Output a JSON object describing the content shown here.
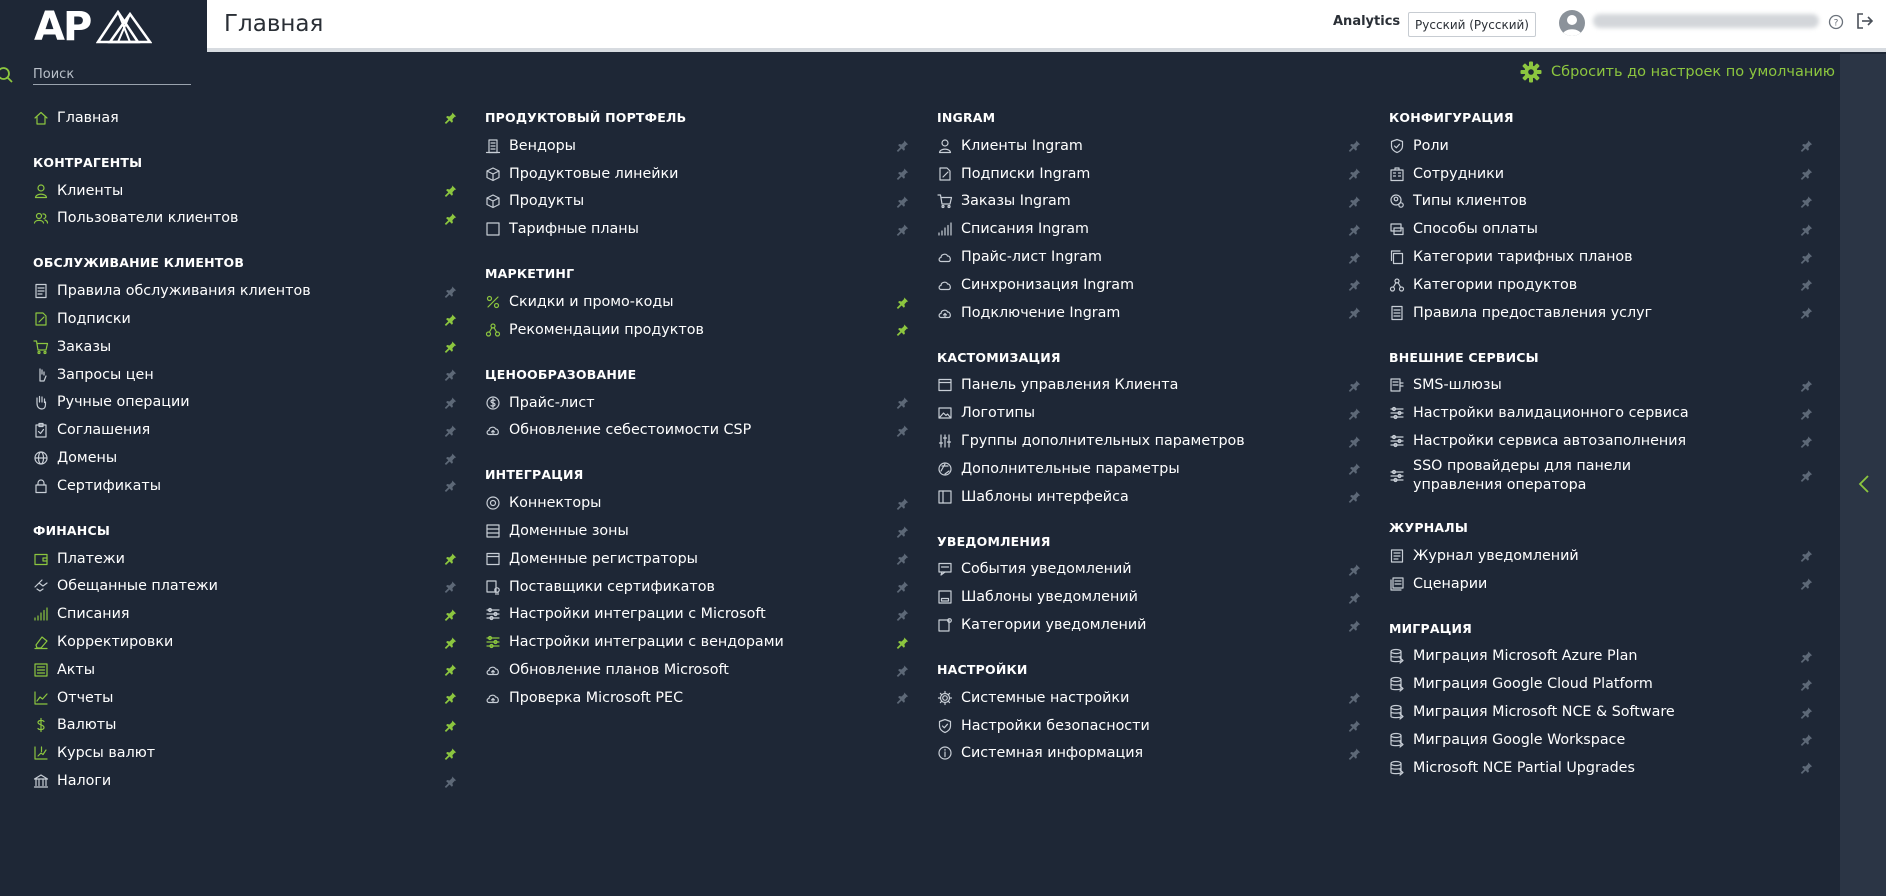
{
  "header": {
    "logo_text": "AP",
    "title": "Главная",
    "analytics_label": "Analytics",
    "language": "Русский (Русский)"
  },
  "search": {
    "placeholder": "Поиск",
    "value": ""
  },
  "reset_label": "Сбросить до настроек по умолчанию",
  "colors": {
    "accent": "#8cc63f",
    "background": "#1e2736",
    "pin_inactive": "#5d6877",
    "icon_outline": "#c8ced6"
  },
  "columns": [
    {
      "sections": [
        {
          "title": "",
          "items": [
            {
              "label": "Главная",
              "icon": "home-icon",
              "pinned": true,
              "accent_icon": true
            }
          ]
        },
        {
          "title": "КОНТРАГЕНТЫ",
          "items": [
            {
              "label": "Клиенты",
              "icon": "user-icon",
              "pinned": true,
              "accent_icon": true
            },
            {
              "label": "Пользователи клиентов",
              "icon": "users-icon",
              "pinned": true,
              "accent_icon": true
            }
          ]
        },
        {
          "title": "ОБСЛУЖИВАНИЕ КЛИЕНТОВ",
          "items": [
            {
              "label": "Правила обслуживания клиентов",
              "icon": "document-icon",
              "pinned": false
            },
            {
              "label": "Подписки",
              "icon": "edit-icon",
              "pinned": true,
              "accent_icon": true
            },
            {
              "label": "Заказы",
              "icon": "cart-icon",
              "pinned": true,
              "accent_icon": true
            },
            {
              "label": "Запросы цен",
              "icon": "hand-icon",
              "pinned": false
            },
            {
              "label": "Ручные операции",
              "icon": "hand-palm-icon",
              "pinned": false
            },
            {
              "label": "Соглашения",
              "icon": "clipboard-icon",
              "pinned": false
            },
            {
              "label": "Домены",
              "icon": "globe-icon",
              "pinned": false
            },
            {
              "label": "Сертификаты",
              "icon": "lock-icon",
              "pinned": false
            }
          ]
        },
        {
          "title": "ФИНАНСЫ",
          "items": [
            {
              "label": "Платежи",
              "icon": "wallet-icon",
              "pinned": true,
              "accent_icon": true
            },
            {
              "label": "Обещанные платежи",
              "icon": "handshake-icon",
              "pinned": false
            },
            {
              "label": "Списания",
              "icon": "signal-icon",
              "pinned": true,
              "accent_icon": true
            },
            {
              "label": "Корректировки",
              "icon": "eraser-icon",
              "pinned": true,
              "accent_icon": true
            },
            {
              "label": "Акты",
              "icon": "list-icon",
              "pinned": true,
              "accent_icon": true
            },
            {
              "label": "Отчеты",
              "icon": "chart-icon",
              "pinned": true,
              "accent_icon": true
            },
            {
              "label": "Валюты",
              "icon": "dollar-icon",
              "pinned": true,
              "accent_icon": true
            },
            {
              "label": "Курсы валют",
              "icon": "rate-icon",
              "pinned": true,
              "accent_icon": true
            },
            {
              "label": "Налоги",
              "icon": "bank-icon",
              "pinned": false
            }
          ]
        }
      ]
    },
    {
      "sections": [
        {
          "title": "ПРОДУКТОВЫЙ ПОРТФЕЛЬ",
          "items": [
            {
              "label": "Вендоры",
              "icon": "building-icon",
              "pinned": false
            },
            {
              "label": "Продуктовые линейки",
              "icon": "box-icon",
              "pinned": false
            },
            {
              "label": "Продукты",
              "icon": "cube-icon",
              "pinned": false
            },
            {
              "label": "Тарифные планы",
              "icon": "square-icon",
              "pinned": false
            }
          ]
        },
        {
          "title": "МАРКЕТИНГ",
          "items": [
            {
              "label": "Скидки и промо-коды",
              "icon": "percent-icon",
              "pinned": true,
              "accent_icon": true
            },
            {
              "label": "Рекомендации продуктов",
              "icon": "network-icon",
              "pinned": true,
              "accent_icon": true
            }
          ]
        },
        {
          "title": "ЦЕНООБРАЗОВАНИЕ",
          "items": [
            {
              "label": "Прайс-лист",
              "icon": "coin-icon",
              "pinned": false
            },
            {
              "label": "Обновление себестоимости CSP",
              "icon": "cloud-upload-icon",
              "pinned": false
            }
          ]
        },
        {
          "title": "ИНТЕГРАЦИЯ",
          "items": [
            {
              "label": "Коннекторы",
              "icon": "connector-icon",
              "pinned": false
            },
            {
              "label": "Доменные зоны",
              "icon": "server-icon",
              "pinned": false
            },
            {
              "label": "Доменные регистраторы",
              "icon": "window-icon",
              "pinned": false
            },
            {
              "label": "Поставщики сертификатов",
              "icon": "certificate-icon",
              "pinned": false
            },
            {
              "label": "Настройки интеграции с Microsoft",
              "icon": "sliders-icon",
              "pinned": false
            },
            {
              "label": "Настройки интеграции с вендорами",
              "icon": "sliders-icon",
              "pinned": true,
              "accent_icon": true
            },
            {
              "label": "Обновление планов Microsoft",
              "icon": "cloud-upload-icon",
              "pinned": false
            },
            {
              "label": "Проверка Microsoft PEC",
              "icon": "cloud-upload-icon",
              "pinned": false
            }
          ]
        }
      ]
    },
    {
      "sections": [
        {
          "title": "INGRAM",
          "items": [
            {
              "label": "Клиенты Ingram",
              "icon": "user-icon",
              "pinned": false
            },
            {
              "label": "Подписки Ingram",
              "icon": "edit-icon",
              "pinned": false
            },
            {
              "label": "Заказы Ingram",
              "icon": "cart-icon",
              "pinned": false
            },
            {
              "label": "Списания Ingram",
              "icon": "signal-icon",
              "pinned": false
            },
            {
              "label": "Прайс-лист Ingram",
              "icon": "cloud-icon",
              "pinned": false
            },
            {
              "label": "Синхронизация Ingram",
              "icon": "cloud-icon",
              "pinned": false
            },
            {
              "label": "Подключение Ingram",
              "icon": "cloud-upload-icon",
              "pinned": false
            }
          ]
        },
        {
          "title": "КАСТОМИЗАЦИЯ",
          "items": [
            {
              "label": "Панель управления Клиента",
              "icon": "window-icon",
              "pinned": false
            },
            {
              "label": "Логотипы",
              "icon": "image-icon",
              "pinned": false
            },
            {
              "label": "Группы дополнительных параметров",
              "icon": "equalizer-icon",
              "pinned": false
            },
            {
              "label": "Дополнительные параметры",
              "icon": "aperture-icon",
              "pinned": false
            },
            {
              "label": "Шаблоны интерфейса",
              "icon": "template-icon",
              "pinned": false
            }
          ]
        },
        {
          "title": "УВЕДОМЛЕНИЯ",
          "items": [
            {
              "label": "События уведомлений",
              "icon": "message-icon",
              "pinned": false
            },
            {
              "label": "Шаблоны уведомлений",
              "icon": "template-mail-icon",
              "pinned": false
            },
            {
              "label": "Категории уведомлений",
              "icon": "notify-category-icon",
              "pinned": false
            }
          ]
        },
        {
          "title": "НАСТРОЙКИ",
          "items": [
            {
              "label": "Системные настройки",
              "icon": "gear-icon",
              "pinned": false
            },
            {
              "label": "Настройки безопасности",
              "icon": "shield-icon",
              "pinned": false
            },
            {
              "label": "Системная информация",
              "icon": "info-icon",
              "pinned": false
            }
          ]
        }
      ]
    },
    {
      "sections": [
        {
          "title": "КОНФИГУРАЦИЯ",
          "items": [
            {
              "label": "Роли",
              "icon": "shield-check-icon",
              "pinned": false
            },
            {
              "label": "Сотрудники",
              "icon": "office-icon",
              "pinned": false
            },
            {
              "label": "Типы клиентов",
              "icon": "user-type-icon",
              "pinned": false
            },
            {
              "label": "Способы оплаты",
              "icon": "payment-icon",
              "pinned": false
            },
            {
              "label": "Категории тарифных планов",
              "icon": "copy-icon",
              "pinned": false
            },
            {
              "label": "Категории продуктов",
              "icon": "network-icon",
              "pinned": false
            },
            {
              "label": "Правила предоставления услуг",
              "icon": "rules-icon",
              "pinned": false
            }
          ]
        },
        {
          "title": "ВНЕШНИЕ СЕРВИСЫ",
          "items": [
            {
              "label": "SMS-шлюзы",
              "icon": "sms-icon",
              "pinned": false
            },
            {
              "label": "Настройки валидационного сервиса",
              "icon": "sliders-icon",
              "pinned": false
            },
            {
              "label": "Настройки сервиса автозаполнения",
              "icon": "sliders-icon",
              "pinned": false
            },
            {
              "label": "SSO провайдеры для панели управления оператора",
              "icon": "sliders-icon",
              "pinned": false,
              "tall": true
            }
          ]
        },
        {
          "title": "ЖУРНАЛЫ",
          "items": [
            {
              "label": "Журнал уведомлений",
              "icon": "journal-icon",
              "pinned": false
            },
            {
              "label": "Сценарии",
              "icon": "scenario-icon",
              "pinned": false
            }
          ]
        },
        {
          "title": "МИГРАЦИЯ",
          "items": [
            {
              "label": "Миграция Microsoft Azure Plan",
              "icon": "database-icon",
              "pinned": false
            },
            {
              "label": "Миграция Google Cloud Platform",
              "icon": "database-icon",
              "pinned": false
            },
            {
              "label": "Миграция Microsoft NCE & Software",
              "icon": "database-icon",
              "pinned": false
            },
            {
              "label": "Миграция Google Workspace",
              "icon": "database-icon",
              "pinned": false
            },
            {
              "label": "Microsoft NCE Partial Upgrades",
              "icon": "database-icon",
              "pinned": false
            }
          ]
        }
      ]
    }
  ]
}
